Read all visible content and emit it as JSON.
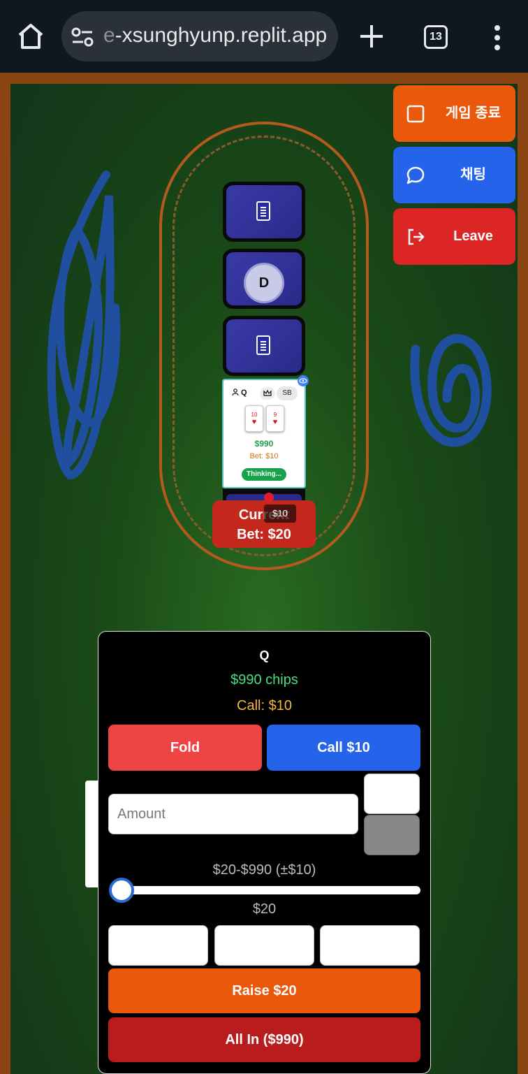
{
  "browser": {
    "url_faded": "e",
    "url_text": "-xsunghyunp.replit.app",
    "tab_count": "13"
  },
  "menu": {
    "end_game": "게임 종료",
    "chat": "채팅",
    "leave": "Leave"
  },
  "table": {
    "dealer_label": "D",
    "current_bet_line1": "Current",
    "current_bet_line2": "Bet: $20",
    "pot_chip": "$10"
  },
  "player_card": {
    "name": "Q",
    "position": "SB",
    "cards": [
      {
        "rank": "10",
        "suit": "♥"
      },
      {
        "rank": "9",
        "suit": "♥"
      }
    ],
    "chips": "$990",
    "bet": "Bet: $10",
    "status": "Thinking..."
  },
  "action_panel": {
    "player_name": "Q",
    "chips": "$990 chips",
    "call_info": "Call: $10",
    "fold_label": "Fold",
    "call_label": "Call $10",
    "amount_placeholder": "Amount",
    "range_label": "$20-$990 (±$10)",
    "slider_value": "$20",
    "slider_fraction": 0.0,
    "raise_label": "Raise $20",
    "allin_label": "All In ($990)"
  },
  "colors": {
    "felt": "#1a4a17",
    "rail": "#8b4513",
    "end_game": "#ea580c",
    "chat": "#2563eb",
    "leave": "#dc2626",
    "fold": "#ef4444",
    "call": "#2563eb",
    "raise": "#ea580c",
    "all_in": "#b91c1c"
  },
  "icons": [
    "home-icon",
    "site-settings-icon",
    "new-tab-icon",
    "tab-switcher-icon",
    "more-menu-icon",
    "stop-square-icon",
    "chat-bubble-icon",
    "logout-icon",
    "card-back-icon",
    "person-icon",
    "crown-icon",
    "eye-icon"
  ]
}
